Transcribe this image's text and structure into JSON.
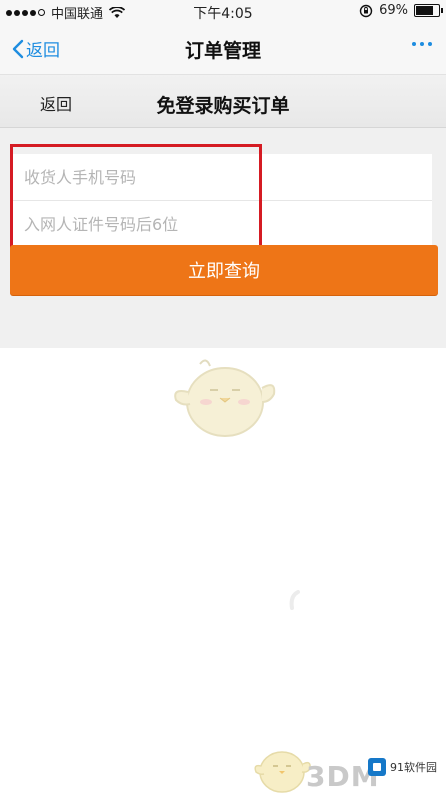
{
  "status_bar": {
    "carrier": "中国联通",
    "time": "下午4:05",
    "battery_percent": "69%",
    "battery_level": 0.69
  },
  "nav": {
    "back_label": "返回",
    "title": "订单管理"
  },
  "sub_header": {
    "back_label": "返回",
    "title": "免登录购买订单"
  },
  "form": {
    "phone_placeholder": "收货人手机号码",
    "id_placeholder": "入网人证件号码后6位",
    "query_label": "立即查询"
  },
  "watermarks": {
    "site": "3DM",
    "logo_text": "91软件园"
  },
  "colors": {
    "accent_blue": "#1e8de0",
    "button_orange": "#ee7517",
    "highlight_red": "#d51b23"
  },
  "icons": [
    "signal-dots-icon",
    "wifi-icon",
    "rotation-lock-icon",
    "battery-icon",
    "chevron-left-icon",
    "more-icon"
  ]
}
